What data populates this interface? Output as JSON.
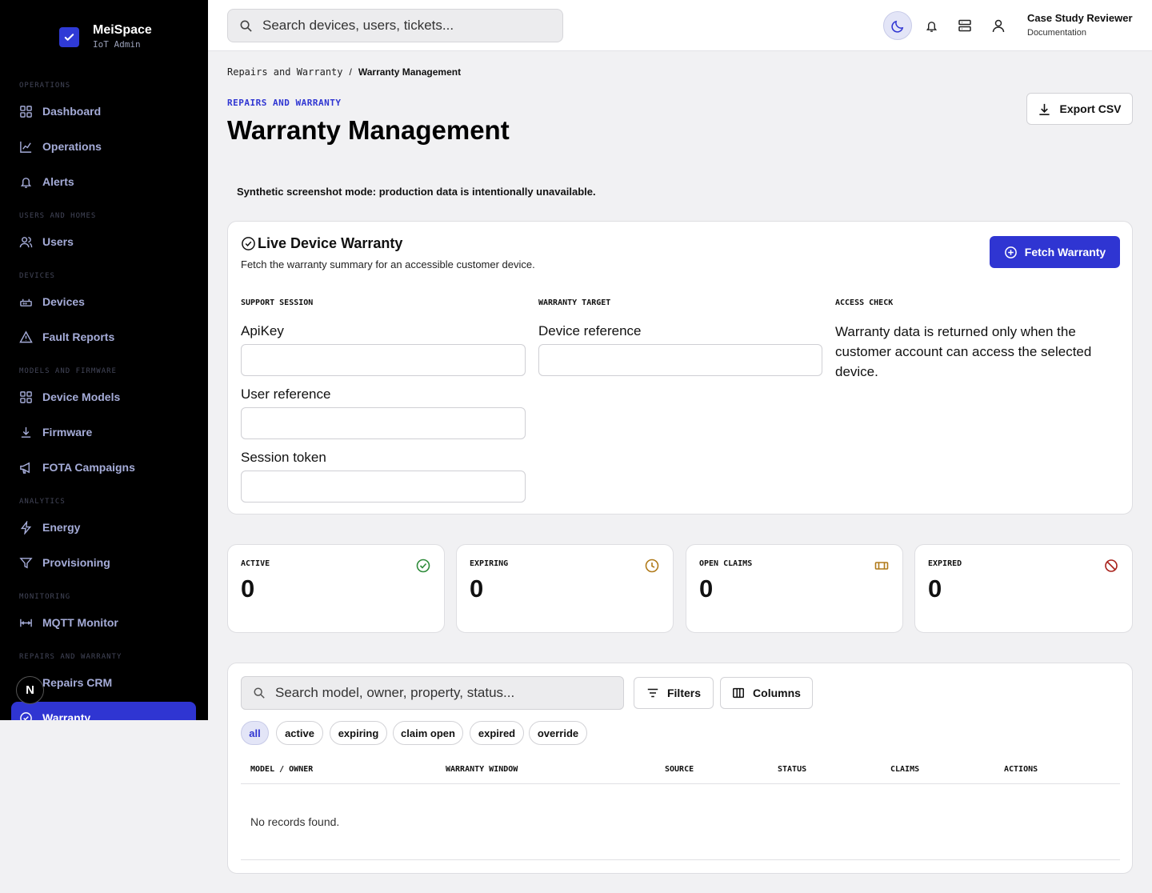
{
  "brand": {
    "name": "MeiSpace",
    "sub": "IoT Admin"
  },
  "sidebar": {
    "sections": [
      "OPERATIONS",
      "USERS AND HOMES",
      "DEVICES",
      "MODELS AND FIRMWARE",
      "ANALYTICS",
      "MONITORING",
      "REPAIRS AND WARRANTY"
    ],
    "items": [
      "Dashboard",
      "Operations",
      "Alerts",
      "Users",
      "Devices",
      "Fault Reports",
      "Device Models",
      "Firmware",
      "FOTA Campaigns",
      "Energy",
      "Provisioning",
      "MQTT Monitor",
      "Repairs CRM",
      "Warranty"
    ],
    "badge": "N"
  },
  "topbar": {
    "search_placeholder": "Search devices, users, tickets...",
    "user_name": "Case Study Reviewer",
    "user_role": "Documentation"
  },
  "breadcrumb": {
    "parent": "Repairs and Warranty",
    "sep": "/",
    "current": "Warranty Management"
  },
  "header": {
    "eyebrow": "REPAIRS AND WARRANTY",
    "title": "Warranty Management",
    "export_label": "Export CSV"
  },
  "notice": "Synthetic screenshot mode: production data is intentionally unavailable.",
  "warranty": {
    "title": "Live Device Warranty",
    "description": "Fetch the warranty summary for an accessible customer device.",
    "fetch_label": "Fetch Warranty",
    "col1": "SUPPORT SESSION",
    "col2": "WARRANTY TARGET",
    "col3": "ACCESS CHECK",
    "fields": {
      "apikey": "ApiKey",
      "user_ref": "User reference",
      "session_token": "Session token",
      "device_ref": "Device reference"
    },
    "access_text": "Warranty data is returned only when the customer account can access the selected device."
  },
  "stats": [
    {
      "label": "ACTIVE",
      "value": "0",
      "color": "#2e8b3a",
      "icon": "check-circle-icon"
    },
    {
      "label": "EXPIRING",
      "value": "0",
      "color": "#b07a1a",
      "icon": "clock-icon"
    },
    {
      "label": "OPEN CLAIMS",
      "value": "0",
      "color": "#b07a1a",
      "icon": "ticket-icon"
    },
    {
      "label": "EXPIRED",
      "value": "0",
      "color": "#a8201a",
      "icon": "ban-icon"
    }
  ],
  "table": {
    "search_placeholder": "Search model, owner, property, status...",
    "filters_label": "Filters",
    "columns_label": "Columns",
    "chips": [
      "all",
      "active",
      "expiring",
      "claim open",
      "expired",
      "override"
    ],
    "headers": [
      "MODEL / OWNER",
      "WARRANTY WINDOW",
      "SOURCE",
      "STATUS",
      "CLAIMS",
      "ACTIONS"
    ],
    "empty": "No records found."
  },
  "colors": {
    "accent": "#2f35d2",
    "sidebar_bg": "#000000"
  }
}
